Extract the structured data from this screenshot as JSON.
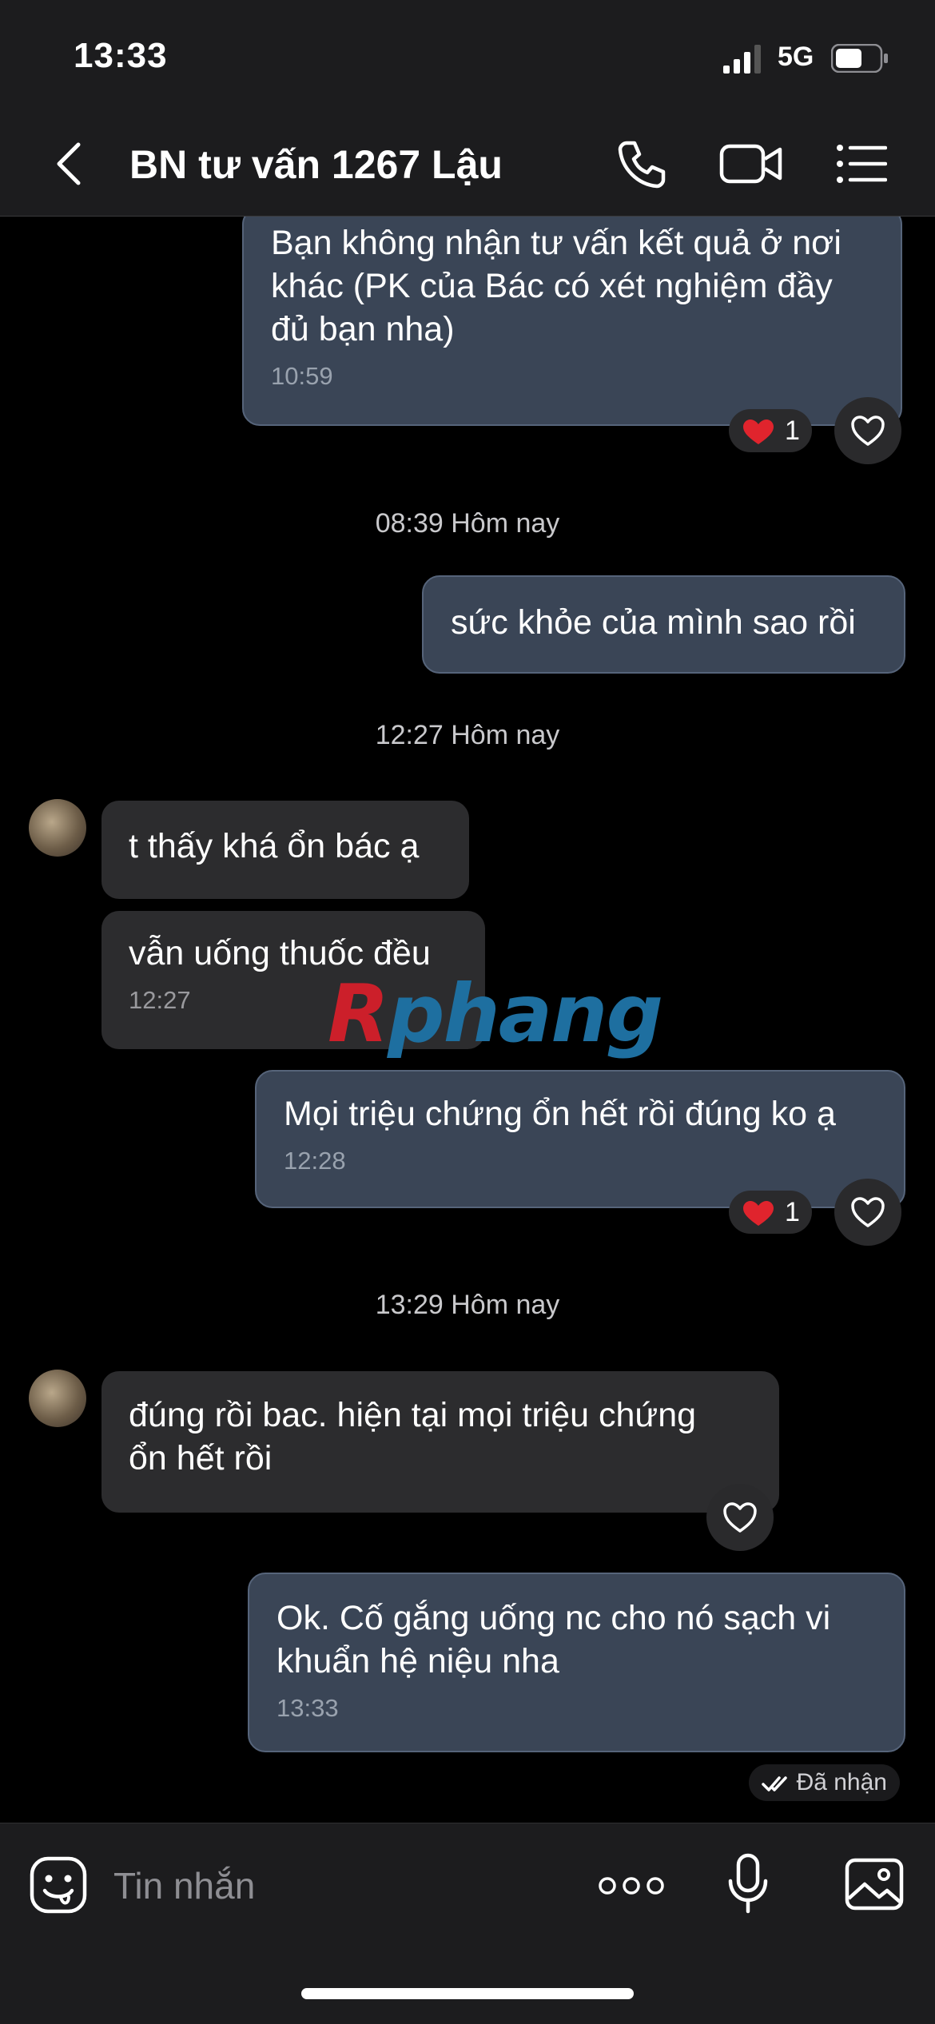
{
  "status_bar": {
    "time": "13:33",
    "network": "5G"
  },
  "header": {
    "title": "BN tư vấn 1267 Lậu"
  },
  "messages": [
    {
      "direction": "outgoing",
      "text": "Bạn không nhận tư vấn kết quả ở nơi\nkhác (PK của Bác có xét nghiệm đầy\nđủ bạn nha)",
      "time": "10:59",
      "reaction": {
        "emoji": "heart",
        "count": "1"
      }
    },
    {
      "type": "separator",
      "text": "08:39 Hôm nay"
    },
    {
      "direction": "outgoing",
      "text": "sức khỏe của mình sao rồi"
    },
    {
      "type": "separator",
      "text": "12:27 Hôm nay"
    },
    {
      "direction": "incoming",
      "text": "t thấy khá ổn bác ạ"
    },
    {
      "direction": "incoming",
      "text": "vẫn uống thuốc đều",
      "time": "12:27"
    },
    {
      "direction": "outgoing",
      "text": "Mọi triệu chứng ổn hết rồi đúng ko ạ",
      "time": "12:28",
      "reaction": {
        "emoji": "heart",
        "count": "1"
      }
    },
    {
      "type": "separator",
      "text": "13:29 Hôm nay"
    },
    {
      "direction": "incoming",
      "text": "đúng rồi bac. hiện tại mọi triệu chứng\nổn hết rồi"
    },
    {
      "direction": "outgoing",
      "text": "Ok. Cố gắng uống nc cho nó sạch vi\nkhuẩn hệ niệu nha",
      "time": "13:33",
      "status": "Đã nhận"
    }
  ],
  "watermark": {
    "part1": "R",
    "part2": "phang"
  },
  "composer": {
    "placeholder": "Tin nhắn"
  },
  "colors": {
    "outgoing_bubble": "#3a4556",
    "incoming_bubble": "#2c2c2e",
    "heart": "#e0242d",
    "background": "#000000"
  }
}
